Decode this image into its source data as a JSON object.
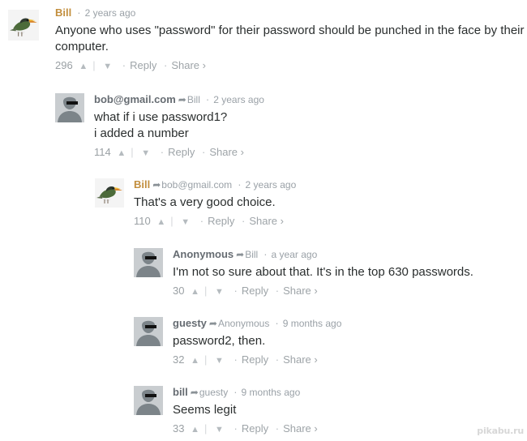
{
  "labels": {
    "dot": "·",
    "reply": "Reply",
    "share": "Share ›",
    "up_icon": "chevron-up-icon",
    "down_icon": "chevron-down-icon",
    "reply_arrow_icon": "reply-arrow-icon"
  },
  "comments": [
    {
      "author": "Bill",
      "time": "2 years ago",
      "lines": [
        "Anyone who uses \"password\" for their password should be punched in the face by their",
        "computer."
      ],
      "votes": "296",
      "avatar": "bird-avatar"
    },
    {
      "author": "bob@gmail.com",
      "reply_to": "Bill",
      "time": "2 years ago",
      "lines": [
        "what if i use password1?",
        "i added a number"
      ],
      "votes": "114",
      "avatar": "default-avatar"
    },
    {
      "author": "Bill",
      "reply_to": "bob@gmail.com",
      "time": "2 years ago",
      "lines": [
        "That's a very good choice."
      ],
      "votes": "110",
      "avatar": "bird-avatar"
    },
    {
      "author": "Anonymous",
      "reply_to": "Bill",
      "time": "a year ago",
      "lines": [
        "I'm not so sure about that. It's in the top 630 passwords."
      ],
      "votes": "30",
      "avatar": "default-avatar"
    },
    {
      "author": "guesty",
      "reply_to": "Anonymous",
      "time": "9 months ago",
      "lines": [
        "password2, then."
      ],
      "votes": "32",
      "avatar": "default-avatar"
    },
    {
      "author": "bill",
      "reply_to": "guesty",
      "time": "9 months ago",
      "lines": [
        "Seems legit"
      ],
      "votes": "33",
      "avatar": "default-avatar"
    }
  ],
  "watermark": "pikabu.ru",
  "colors": {
    "author_gold": "#c28e3d",
    "author_gray": "#666c72",
    "meta": "#9aa1a7",
    "text": "#2a2e2e"
  }
}
